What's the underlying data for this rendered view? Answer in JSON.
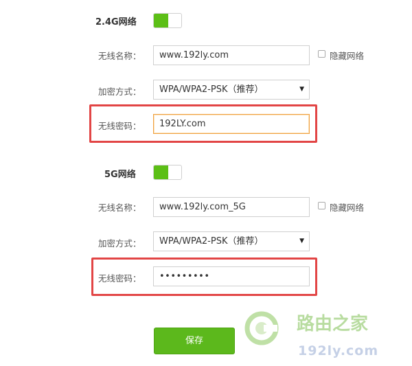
{
  "colors": {
    "accent_green": "#5cbf16",
    "highlight_red": "#e24545",
    "focus_orange": "#f0a040"
  },
  "band_24": {
    "title": "2.4G网络",
    "toggle_on": true,
    "ssid_label": "无线名称：",
    "ssid_value": "www.192ly.com",
    "hide_label": "隐藏网络",
    "hide_checked": false,
    "security_label": "加密方式：",
    "security_value": "WPA/WPA2-PSK（推荐）",
    "password_label": "无线密码：",
    "password_value": "192LY.com"
  },
  "band_5": {
    "title": "5G网络",
    "toggle_on": true,
    "ssid_label": "无线名称：",
    "ssid_value": "www.192ly.com_5G",
    "hide_label": "隐藏网络",
    "hide_checked": false,
    "security_label": "加密方式：",
    "security_value": "WPA/WPA2-PSK（推荐）",
    "password_label": "无线密码：",
    "password_masked": "•••••••••"
  },
  "save_label": "保存",
  "watermark": {
    "title": "路由之家",
    "url": "192ly.com",
    "logo_icon": "router-logo-icon"
  }
}
